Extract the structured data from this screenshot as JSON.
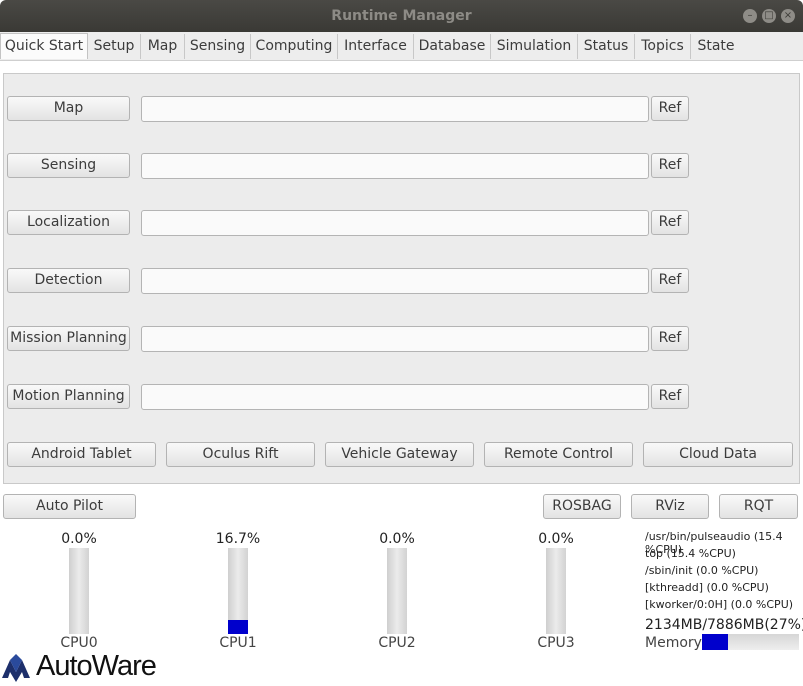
{
  "window": {
    "title": "Runtime Manager"
  },
  "tabs": [
    {
      "label": "Quick Start",
      "active": true
    },
    {
      "label": "Setup"
    },
    {
      "label": "Map"
    },
    {
      "label": "Sensing"
    },
    {
      "label": "Computing"
    },
    {
      "label": "Interface"
    },
    {
      "label": "Database"
    },
    {
      "label": "Simulation"
    },
    {
      "label": "Status"
    },
    {
      "label": "Topics"
    },
    {
      "label": "State"
    }
  ],
  "quickstart": {
    "rows": [
      {
        "label": "Map",
        "value": "",
        "ref": "Ref"
      },
      {
        "label": "Sensing",
        "value": "",
        "ref": "Ref"
      },
      {
        "label": "Localization",
        "value": "",
        "ref": "Ref"
      },
      {
        "label": "Detection",
        "value": "",
        "ref": "Ref"
      },
      {
        "label": "Mission Planning",
        "value": "",
        "ref": "Ref"
      },
      {
        "label": "Motion Planning",
        "value": "",
        "ref": "Ref"
      }
    ],
    "devices": [
      "Android Tablet",
      "Oculus Rift",
      "Vehicle Gateway",
      "Remote Control",
      "Cloud Data"
    ]
  },
  "bottom": {
    "auto_pilot": "Auto Pilot",
    "rosbag": "ROSBAG",
    "rviz": "RViz",
    "rqt": "RQT"
  },
  "cpus": [
    {
      "label": "CPU0",
      "percent": "0.0%",
      "fill": 0.0
    },
    {
      "label": "CPU1",
      "percent": "16.7%",
      "fill": 0.167
    },
    {
      "label": "CPU2",
      "percent": "0.0%",
      "fill": 0.0
    },
    {
      "label": "CPU3",
      "percent": "0.0%",
      "fill": 0.0
    }
  ],
  "processes": [
    "/usr/bin/pulseaudio (15.4 %CPU)",
    "top (15.4 %CPU)",
    "/sbin/init (0.0 %CPU)",
    "[kthreadd] (0.0 %CPU)",
    "[kworker/0:0H] (0.0 %CPU)"
  ],
  "memory": {
    "text": "2134MB/7886MB(27%)",
    "label": "Memory",
    "fill": 0.27
  },
  "logo": {
    "text": "AutoWare"
  },
  "colors": {
    "titlebar": "#3c3b37",
    "bar_fill": "#0000cc"
  }
}
